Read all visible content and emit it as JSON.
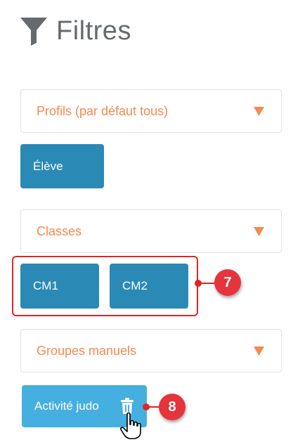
{
  "header": {
    "title": "Filtres",
    "icon": "filter-icon"
  },
  "colors": {
    "accent": "#f5894f",
    "chip": "#2a8ab5",
    "chip_hover": "#45afdf",
    "annotation": "#e02424"
  },
  "filters": {
    "profils": {
      "label": "Profils (par défaut tous)",
      "chips": [
        "Élève"
      ]
    },
    "classes": {
      "label": "Classes",
      "chips": [
        "CM1",
        "CM2"
      ]
    },
    "groupes": {
      "label": "Groupes manuels",
      "chips": [
        "Activité judo"
      ]
    }
  },
  "annotations": {
    "callout_7": "7",
    "callout_8": "8"
  }
}
